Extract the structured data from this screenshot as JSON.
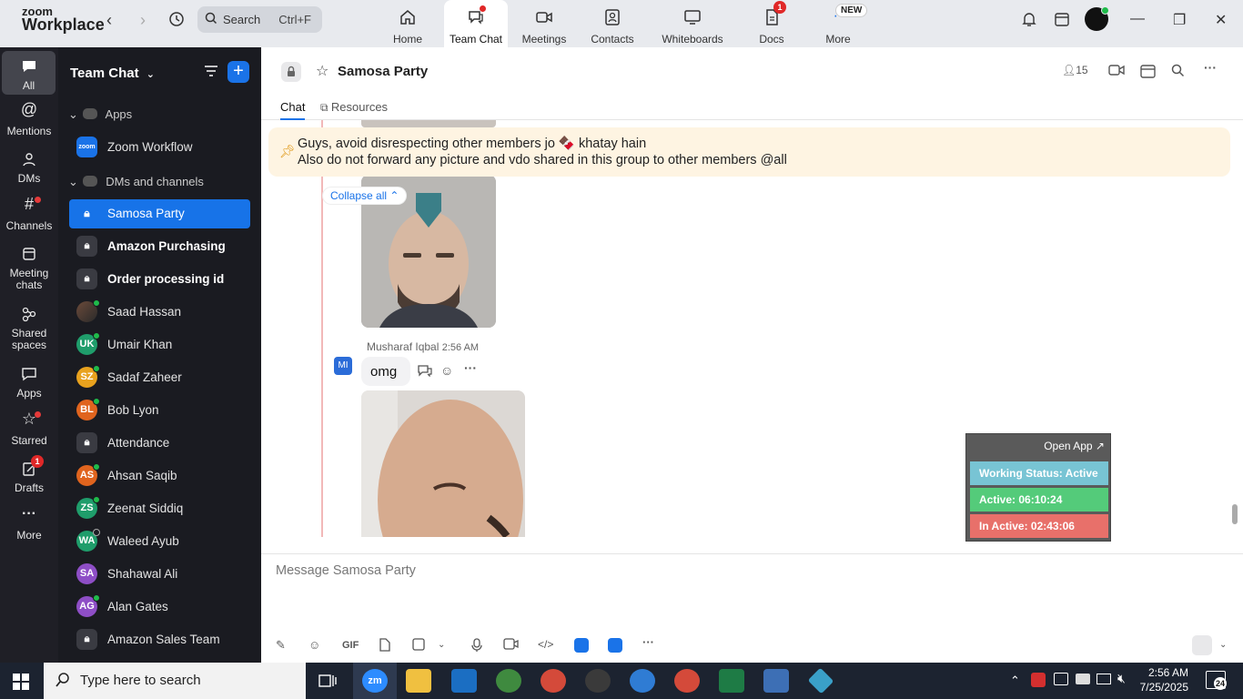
{
  "brand": {
    "line1": "zoom",
    "line2": "Workplace"
  },
  "search": {
    "label": "Search",
    "shortcut": "Ctrl+F"
  },
  "topnav": [
    {
      "label": "Home"
    },
    {
      "label": "Team Chat"
    },
    {
      "label": "Meetings"
    },
    {
      "label": "Contacts"
    },
    {
      "label": "Whiteboards"
    },
    {
      "label": "Docs",
      "badge": "1"
    },
    {
      "label": "More",
      "badge": "NEW"
    }
  ],
  "rail": [
    {
      "label": "All"
    },
    {
      "label": "Mentions"
    },
    {
      "label": "DMs"
    },
    {
      "label": "Channels"
    },
    {
      "label": "Meeting chats"
    },
    {
      "label": "Shared spaces"
    },
    {
      "label": "Apps"
    },
    {
      "label": "Starred"
    },
    {
      "label": "Drafts",
      "badge": "1"
    },
    {
      "label": "More"
    }
  ],
  "sidebar": {
    "title": "Team Chat",
    "sections": {
      "apps": "Apps",
      "dms": "DMs and channels"
    },
    "zoom_app": {
      "icon_text": "zoom",
      "label": "Zoom Workflow"
    },
    "items": [
      {
        "label": "Samosa Party",
        "type": "channel"
      },
      {
        "label": "Amazon Purchasing",
        "type": "channel"
      },
      {
        "label": "Order processing id",
        "type": "channel"
      },
      {
        "label": "Saad Hassan",
        "initials": ""
      },
      {
        "label": "Umair Khan",
        "initials": "UK",
        "color": "#1f9d6b"
      },
      {
        "label": "Sadaf Zaheer",
        "initials": "SZ",
        "color": "#e8a21e"
      },
      {
        "label": "Bob Lyon",
        "initials": "BL",
        "color": "#e0641e"
      },
      {
        "label": "Attendance",
        "type": "channel"
      },
      {
        "label": "Ahsan Saqib",
        "initials": "AS",
        "color": "#e0641e"
      },
      {
        "label": "Zeenat Siddiq",
        "initials": "ZS",
        "color": "#1f9d6b"
      },
      {
        "label": "Waleed Ayub",
        "initials": "WA",
        "color": "#1f9d6b"
      },
      {
        "label": "Shahawal Ali",
        "initials": "SA",
        "color": "#8e4ec6"
      },
      {
        "label": "Alan Gates",
        "initials": "AG",
        "color": "#8e4ec6"
      },
      {
        "label": "Amazon Sales Team",
        "type": "channel"
      }
    ]
  },
  "channel": {
    "name": "Samosa Party",
    "members": "15",
    "tabs": [
      "Chat",
      "Resources"
    ]
  },
  "pinned": {
    "line1": "Guys, avoid disrespecting other members jo 🍫 khatay hain",
    "line2": "Also do not forward any picture and vdo shared in this group to other members @all"
  },
  "collapse_label": "Collapse all",
  "message": {
    "author": "Musharaf Iqbal",
    "time": "2:56 AM",
    "initials": "MI",
    "text": "omg"
  },
  "widget": {
    "open_app": "Open App ↗",
    "working_status": "Working Status: Active",
    "active": "Active: 06:10:24",
    "inactive": "In Active: 02:43:06"
  },
  "composer": {
    "placeholder": "Message Samosa Party",
    "gif": "GIF"
  },
  "taskbar": {
    "search": "Type here to search",
    "time": "2:56 AM",
    "date": "7/25/2025",
    "notifications": "24"
  },
  "colors": {
    "accent": "#1a73e8",
    "sidebar_bg": "#1a1b21",
    "rail_bg": "#1f1f26",
    "pinned_bg": "#fef4e2",
    "widget_status": "#78c4d4",
    "widget_active": "#54cb7a",
    "widget_inactive": "#e8706a"
  }
}
